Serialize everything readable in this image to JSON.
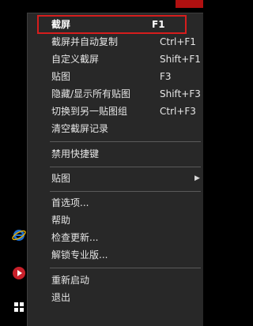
{
  "menu": {
    "items": [
      {
        "label": "截屏",
        "shortcut": "F1"
      },
      {
        "label": "截屏并自动复制",
        "shortcut": "Ctrl+F1"
      },
      {
        "label": "自定义截屏",
        "shortcut": "Shift+F1"
      },
      {
        "label": "贴图",
        "shortcut": "F3"
      },
      {
        "label": "隐藏/显示所有贴图",
        "shortcut": "Shift+F3"
      },
      {
        "label": "切换到另一贴图组",
        "shortcut": "Ctrl+F3"
      },
      {
        "label": "清空截屏记录",
        "shortcut": ""
      },
      {
        "label": "禁用快捷键",
        "shortcut": ""
      },
      {
        "label": "贴图",
        "shortcut": ""
      },
      {
        "label": "首选项...",
        "shortcut": ""
      },
      {
        "label": "帮助",
        "shortcut": ""
      },
      {
        "label": "检查更新...",
        "shortcut": ""
      },
      {
        "label": "解锁专业版...",
        "shortcut": ""
      },
      {
        "label": "重新启动",
        "shortcut": ""
      },
      {
        "label": "退出",
        "shortcut": ""
      }
    ]
  },
  "colors": {
    "highlight_border": "#d61d1d",
    "menu_bg": "#282828",
    "text": "#e6e6e6"
  },
  "icons": {
    "submenu": "chevron-right-icon",
    "taskbar": [
      "ie-icon",
      "media-player-icon",
      "pin-icon"
    ]
  }
}
